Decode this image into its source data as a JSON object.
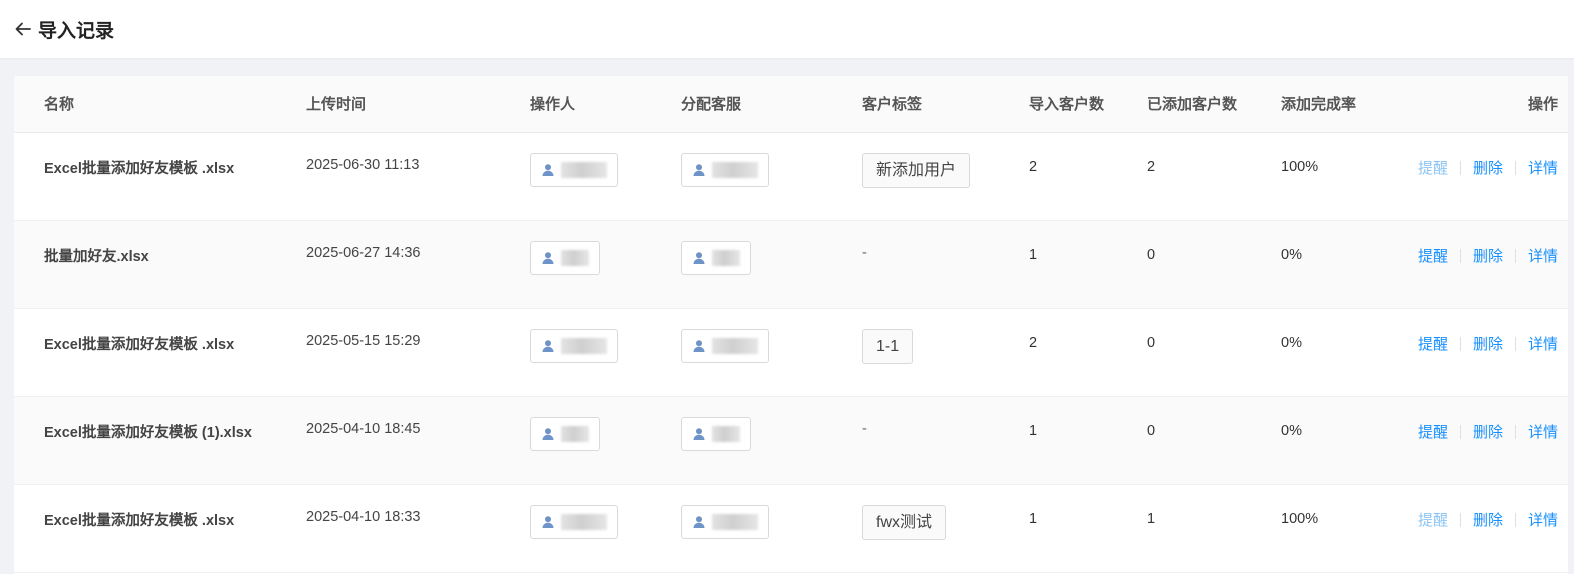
{
  "header": {
    "title": "导入记录"
  },
  "columns": {
    "name": "名称",
    "upload_time": "上传时间",
    "operator": "操作人",
    "assigned_agent": "分配客服",
    "customer_tag": "客户标签",
    "imported_count": "导入客户数",
    "added_count": "已添加客户数",
    "completion_rate": "添加完成率",
    "actions": "操作"
  },
  "actions": {
    "remind": "提醒",
    "delete": "删除",
    "detail": "详情"
  },
  "rows": [
    {
      "name": "Excel批量添加好友模板 .xlsx",
      "time": "2025-06-30 11:13",
      "tag": "新添加用户",
      "imported": "2",
      "added": "2",
      "rate": "100%",
      "remind_disabled": true
    },
    {
      "name": "批量加好友.xlsx",
      "time": "2025-06-27 14:36",
      "tag": "-",
      "imported": "1",
      "added": "0",
      "rate": "0%",
      "remind_disabled": false
    },
    {
      "name": "Excel批量添加好友模板 .xlsx",
      "time": "2025-05-15 15:29",
      "tag": "1-1",
      "imported": "2",
      "added": "0",
      "rate": "0%",
      "remind_disabled": false
    },
    {
      "name": "Excel批量添加好友模板 (1).xlsx",
      "time": "2025-04-10 18:45",
      "tag": "-",
      "imported": "1",
      "added": "0",
      "rate": "0%",
      "remind_disabled": false
    },
    {
      "name": "Excel批量添加好友模板 .xlsx",
      "time": "2025-04-10 18:33",
      "tag": "fwx测试",
      "imported": "1",
      "added": "1",
      "rate": "100%",
      "remind_disabled": true
    }
  ],
  "icons": {
    "back": "arrow-left-icon",
    "user": "user-icon"
  },
  "colors": {
    "link": "#1890ff",
    "link_disabled": "#8cc4f5",
    "user_icon": "#6e93c6"
  }
}
